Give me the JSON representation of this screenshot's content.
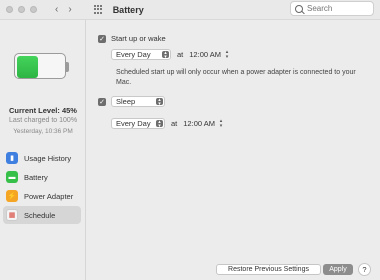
{
  "window": {
    "title": "Battery"
  },
  "search": {
    "placeholder": "Search"
  },
  "battery": {
    "current_level": "Current Level: 45%",
    "level_fraction": 0.45,
    "last_charged": "Last charged to 100%",
    "last_charged_time": "Yesterday, 10:36 PM"
  },
  "sidebar": {
    "items": [
      {
        "label": "Usage History",
        "icon": "usage-history-icon"
      },
      {
        "label": "Battery",
        "icon": "battery-icon"
      },
      {
        "label": "Power Adapter",
        "icon": "power-adapter-icon"
      },
      {
        "label": "Schedule",
        "icon": "schedule-icon",
        "selected": true
      }
    ]
  },
  "schedule": {
    "startup": {
      "label": "Start up or wake",
      "checked": true,
      "day": "Every Day",
      "at": "at",
      "time": "12:00 AM",
      "note": "Scheduled start up will only occur when a power adapter is connected to your Mac."
    },
    "sleep": {
      "action": "Sleep",
      "checked": true,
      "day": "Every Day",
      "at": "at",
      "time": "12:00 AM"
    }
  },
  "buttons": {
    "restore": "Restore Previous Settings",
    "apply": "Apply",
    "help": "?"
  },
  "colors": {
    "battery_fill": "#2eb545",
    "usage": "#3f7fe0",
    "battery": "#36c04a",
    "adapter": "#f5a524",
    "schedule": "#d43a2f"
  }
}
